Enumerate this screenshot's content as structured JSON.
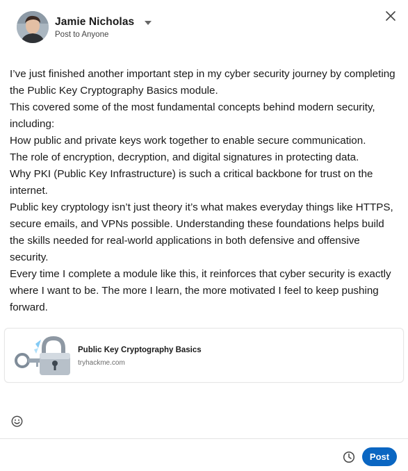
{
  "header": {
    "author_name": "Jamie Nicholas",
    "visibility": "Post to Anyone",
    "avatar_icon": "user-avatar"
  },
  "editor": {
    "paragraphs": [
      "I’ve just finished another important step in my cyber security journey by completing the Public Key Cryptography Basics module.",
      "This covered some of the most fundamental concepts behind modern security, including:",
      "How public and private keys work together to enable secure communication.",
      "The role of encryption, decryption, and digital signatures in protecting data.",
      "Why PKI (Public Key Infrastructure) is such a critical backbone for trust on the internet.",
      "Public key cryptology isn’t just theory it’s what makes everyday things like HTTPS, secure emails, and VPNs possible. Understanding these foundations helps build the skills needed for real-world applications in both defensive and offensive security.",
      "Every time I complete a module like this, it reinforces that cyber security is exactly where I want to be. The more I learn, the more motivated I feel to keep pushing forward."
    ]
  },
  "link_preview": {
    "title": "Public Key Cryptography Basics",
    "domain": "tryhackme.com",
    "thumbnail_icon": "padlock-key-icon"
  },
  "footer": {
    "post_label": "Post",
    "schedule_icon": "clock-icon",
    "emoji_icon": "smiley-icon"
  },
  "colors": {
    "primary": "#0a66c2",
    "text": "#191919",
    "muted": "#666666",
    "divider": "#e3e3e3"
  }
}
